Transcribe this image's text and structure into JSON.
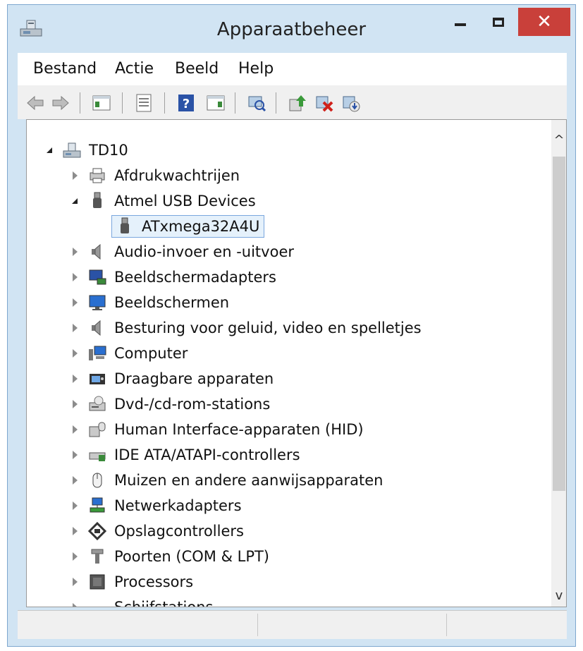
{
  "window": {
    "title": "Apparaatbeheer",
    "close_glyph": "✕"
  },
  "menu": {
    "items": [
      "Bestand",
      "Actie",
      "Beeld",
      "Help"
    ]
  },
  "toolbar": {
    "buttons": [
      "back-arrow-icon",
      "forward-arrow-icon",
      "show-hide-console-tree-icon",
      "properties-icon",
      "help-icon",
      "action-pane-icon",
      "scan-hardware-icon",
      "update-driver-icon",
      "uninstall-device-icon",
      "disable-device-icon"
    ]
  },
  "tree": {
    "root": {
      "label": "TD10",
      "expanded": true
    },
    "items": [
      {
        "label": "Afdrukwachtrijen",
        "icon": "printer-icon",
        "expanded": false
      },
      {
        "label": "Atmel USB Devices",
        "icon": "usb-plug-icon",
        "expanded": true
      },
      {
        "label": "ATxmega32A4U",
        "icon": "usb-plug-icon",
        "child": true,
        "selected": true
      },
      {
        "label": "Audio-invoer en -uitvoer",
        "icon": "speaker-icon",
        "expanded": false
      },
      {
        "label": "Beeldschermadapters",
        "icon": "display-adapter-icon",
        "expanded": false
      },
      {
        "label": "Beeldschermen",
        "icon": "monitor-icon",
        "expanded": false
      },
      {
        "label": "Besturing voor geluid, video en spelletjes",
        "icon": "speaker-icon",
        "expanded": false
      },
      {
        "label": "Computer",
        "icon": "computer-icon",
        "expanded": false
      },
      {
        "label": "Draagbare apparaten",
        "icon": "portable-device-icon",
        "expanded": false
      },
      {
        "label": "Dvd-/cd-rom-stations",
        "icon": "dvd-drive-icon",
        "expanded": false
      },
      {
        "label": "Human Interface-apparaten (HID)",
        "icon": "hid-icon",
        "expanded": false
      },
      {
        "label": "IDE ATA/ATAPI-controllers",
        "icon": "ide-controller-icon",
        "expanded": false
      },
      {
        "label": "Muizen en andere aanwijsapparaten",
        "icon": "mouse-icon",
        "expanded": false
      },
      {
        "label": "Netwerkadapters",
        "icon": "network-adapter-icon",
        "expanded": false
      },
      {
        "label": "Opslagcontrollers",
        "icon": "storage-controller-icon",
        "expanded": false
      },
      {
        "label": "Poorten (COM & LPT)",
        "icon": "port-icon",
        "expanded": false
      },
      {
        "label": "Processors",
        "icon": "processor-icon",
        "expanded": false
      },
      {
        "label": "Schijfstations",
        "icon": "disk-drive-icon",
        "expanded": false
      }
    ]
  },
  "scrollbar": {
    "up_glyph": "^",
    "down_glyph": "v"
  }
}
